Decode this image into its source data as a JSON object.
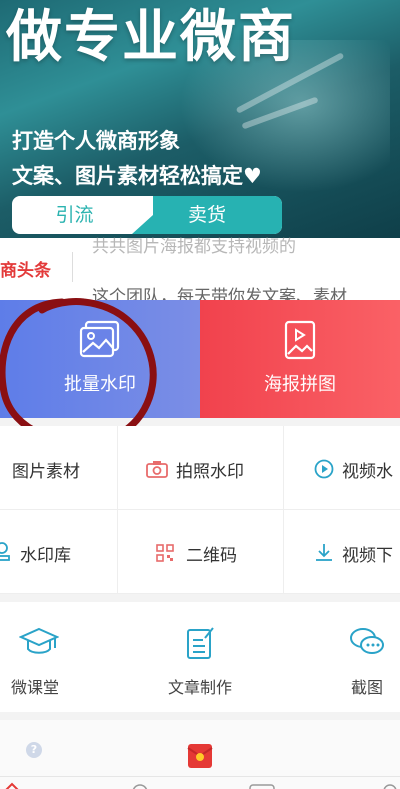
{
  "banner": {
    "headline": "做专业微商",
    "line1": "打造个人微商形象",
    "line2": "文案、图片素材轻松搞定♥",
    "tab1": "引流",
    "tab2": "卖货"
  },
  "news": {
    "label": "商头条",
    "text1": "共共图片海报都支持视频的",
    "text2": "这个团队，每天带你发文案、素材"
  },
  "features": [
    {
      "label": "批量水印",
      "icon": "image-stack-icon"
    },
    {
      "label": "海报拼图",
      "icon": "poster-icon"
    }
  ],
  "tools": [
    {
      "label": "图片素材",
      "icon": "image-icon"
    },
    {
      "label": "拍照水印",
      "icon": "camera-icon"
    },
    {
      "label": "视频水",
      "icon": "video-play-icon"
    },
    {
      "label": "水印库",
      "icon": "stamp-icon"
    },
    {
      "label": "二维码",
      "icon": "qrcode-icon"
    },
    {
      "label": "视频下",
      "icon": "download-icon"
    }
  ],
  "shortcuts": [
    {
      "label": "微课堂",
      "icon": "graduation-cap-icon"
    },
    {
      "label": "文章制作",
      "icon": "edit-document-icon"
    },
    {
      "label": "截图",
      "icon": "chat-bubbles-icon"
    }
  ],
  "tabbar": {
    "help": "?"
  },
  "colors": {
    "banner_teal": "#2bb3b0",
    "feature_blue": "#6a83e8",
    "feature_red": "#f44b53",
    "accent_red": "#e33a3a",
    "tool_icon_red": "#e86b6b",
    "tool_icon_blue": "#2aa3c8"
  }
}
